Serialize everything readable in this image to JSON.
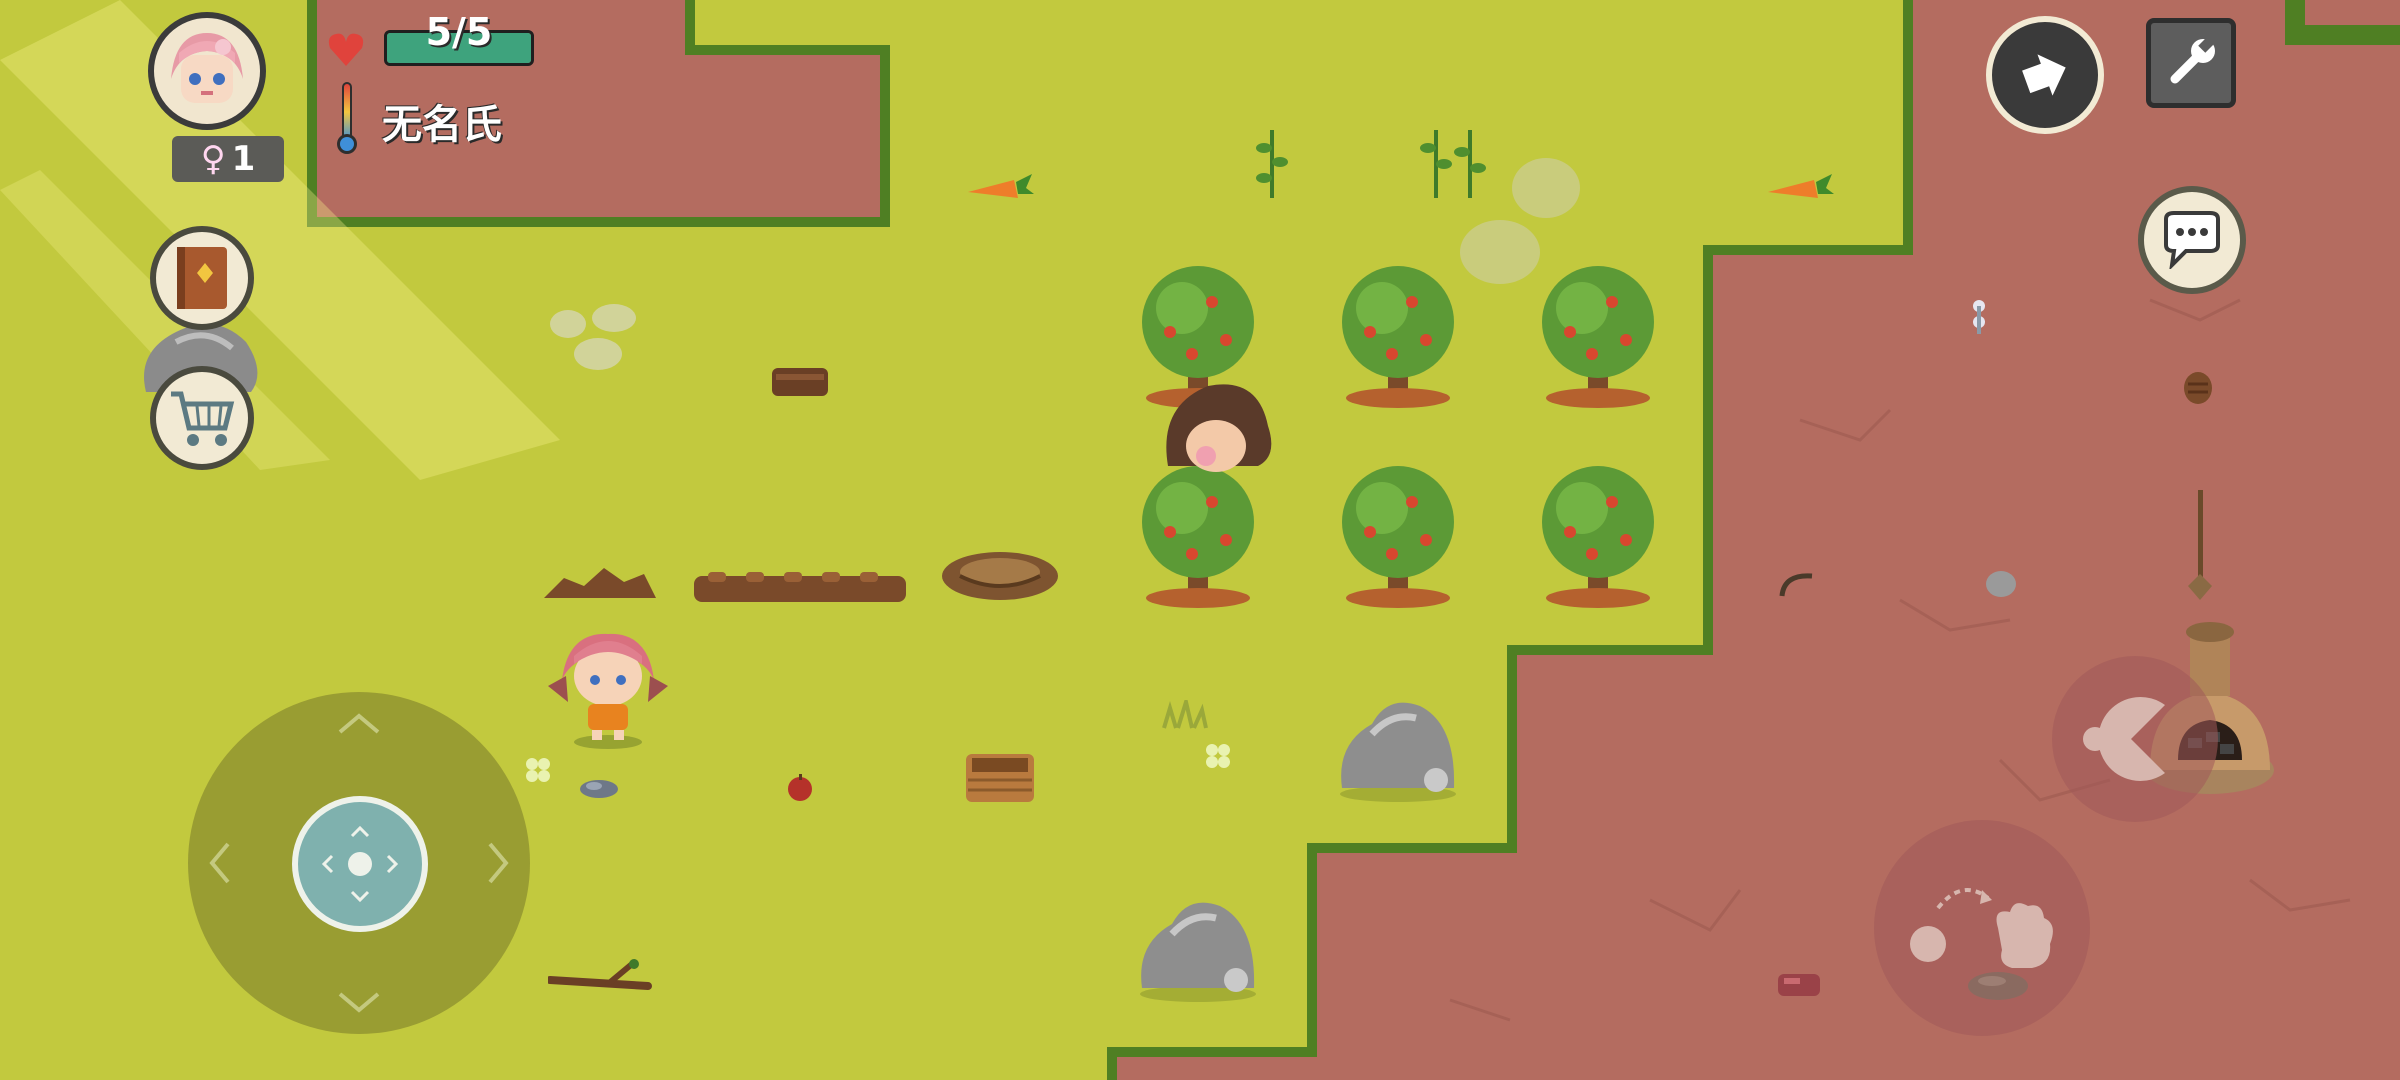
{
  "player": {
    "name": "无名氏",
    "gender_symbol": "♀",
    "generation": "1",
    "health_text": "5/5",
    "health_fraction": 1.0
  },
  "colors": {
    "grass": "#c2c93e",
    "dirt": "#b46c60",
    "hedge": "#4f7f23",
    "health_fill": "#3ea37d",
    "heart": "#e0433c"
  },
  "hud": {
    "left_buttons": [
      "recipe-book-icon",
      "shopping-cart-icon"
    ],
    "top_right_buttons": [
      "exit-arrow-icon",
      "wrench-icon",
      "chat-bubble-icon"
    ],
    "action_buttons": [
      "eat-icon",
      "use-hand-icon"
    ]
  },
  "world_objects": [
    "apple-tree",
    "apple-tree",
    "apple-tree",
    "apple-tree",
    "apple-tree",
    "apple-tree",
    "carrot",
    "carrot",
    "milkweed",
    "milkweed",
    "big-rock",
    "big-rock",
    "stone-pile",
    "dug-soil",
    "tilled-row",
    "bird-nest",
    "woven-basket",
    "wooden-log",
    "apple",
    "flint",
    "branch",
    "kiln",
    "pine-cone",
    "straight-shaft"
  ]
}
